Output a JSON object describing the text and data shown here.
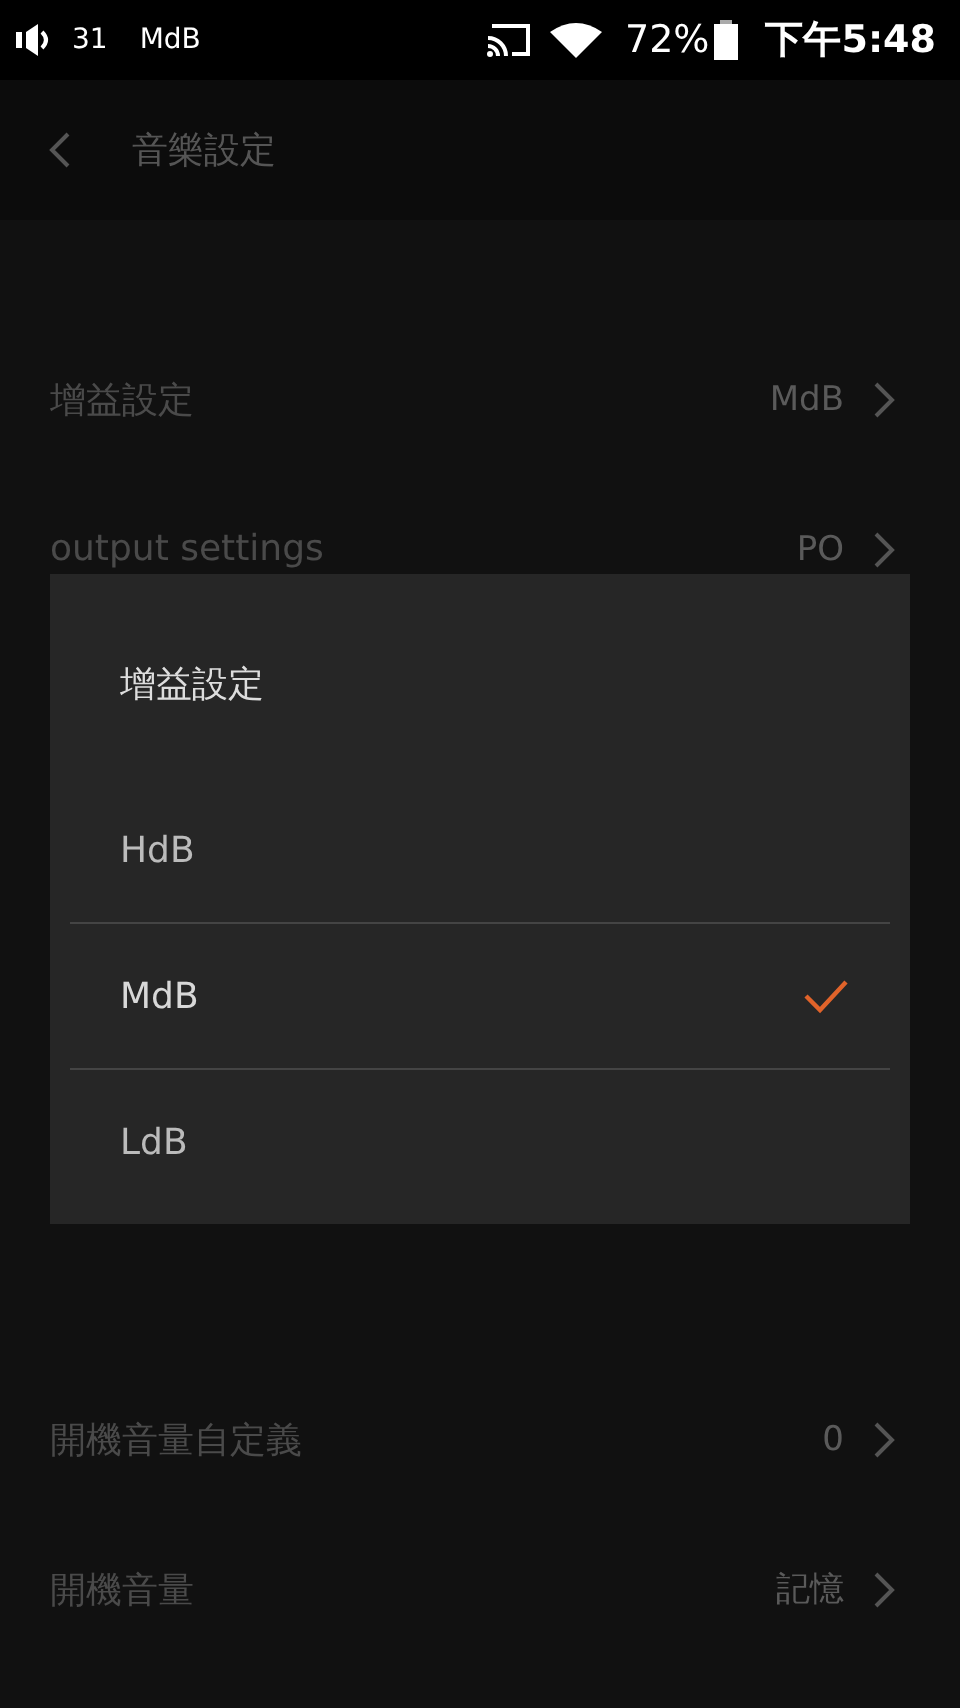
{
  "status_bar": {
    "volume": "31",
    "gain": "MdB",
    "battery": "72%",
    "time": "下午5:48"
  },
  "header": {
    "title": "音樂設定"
  },
  "settings": [
    {
      "label": "增益設定",
      "value": "MdB"
    },
    {
      "label": "output settings",
      "value": "PO"
    }
  ],
  "settings_lower": [
    {
      "label": "開機音量自定義",
      "value": "0"
    },
    {
      "label": "開機音量",
      "value": "記憶"
    }
  ],
  "dialog": {
    "title": "增益設定",
    "options": [
      {
        "label": "HdB",
        "selected": false
      },
      {
        "label": "MdB",
        "selected": true
      },
      {
        "label": "LdB",
        "selected": false
      }
    ]
  }
}
